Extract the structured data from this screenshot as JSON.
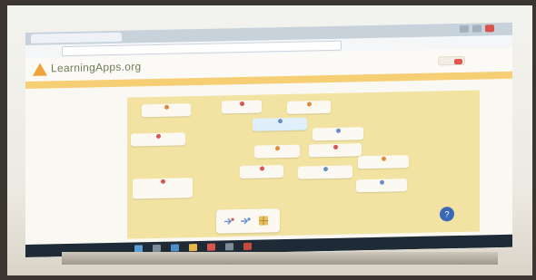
{
  "browser": {
    "tab_title": "",
    "address": "",
    "window_buttons": [
      "minimize",
      "maximize",
      "close"
    ]
  },
  "site": {
    "logo_icon": "triangle-logo-icon",
    "title": "LearningApps.org",
    "header_button_label": "",
    "breadcrumb": ""
  },
  "canvas": {
    "cards": [
      {
        "label": "",
        "pin": "orange"
      },
      {
        "label": "",
        "pin": "red"
      },
      {
        "label": "",
        "pin": "orange"
      },
      {
        "label": "",
        "pin": "blue"
      },
      {
        "label": "",
        "pin": "red"
      },
      {
        "label": "",
        "pin": "blue"
      },
      {
        "label": "",
        "pin": "orange"
      },
      {
        "label": "",
        "pin": "red"
      },
      {
        "label": "",
        "pin": "orange"
      },
      {
        "label": "",
        "pin": "red"
      },
      {
        "label": "",
        "pin": "blue"
      },
      {
        "label": "",
        "pin": "red"
      },
      {
        "label": "",
        "pin": "blue"
      }
    ],
    "game_panel_icons": [
      "arrow-figure-icon",
      "arrow-figure-icon",
      "grid-icon"
    ],
    "fab_icon": "help-icon"
  },
  "colors": {
    "nav_bar": "#f6cf74",
    "canvas_bg": "#f2e3a3",
    "accent_blue": "#3a67b8",
    "accent_red": "#e3564f"
  },
  "taskbar": {
    "icons": [
      "start-icon",
      "search-icon",
      "browser-icon",
      "folder-icon",
      "media-icon",
      "store-icon",
      "office-icon"
    ],
    "tray_text": ""
  }
}
